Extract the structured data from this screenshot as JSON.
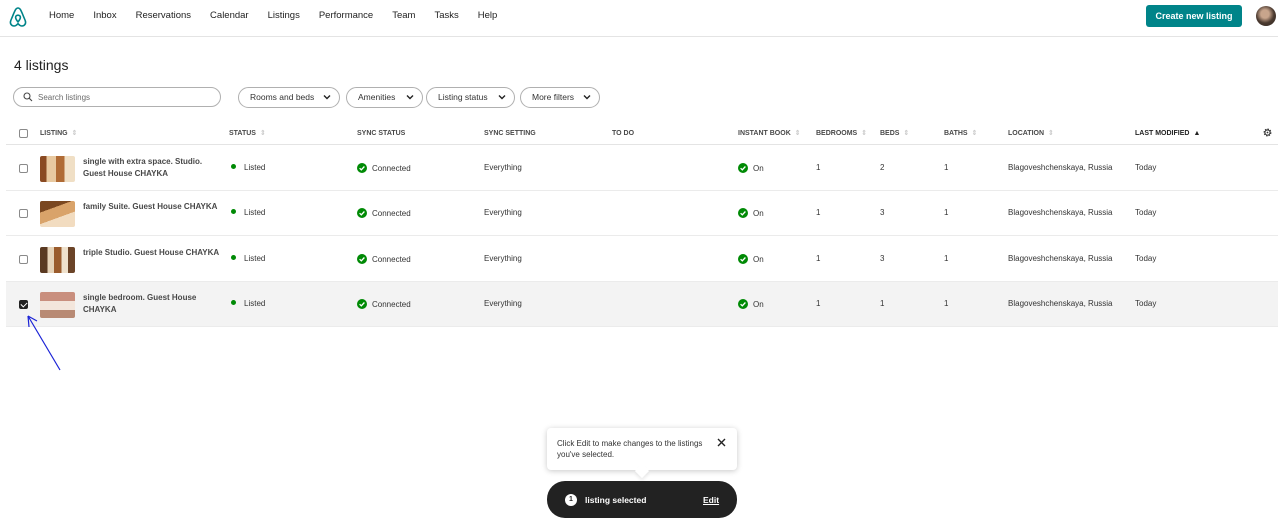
{
  "nav": {
    "items": [
      "Home",
      "Inbox",
      "Reservations",
      "Calendar",
      "Listings",
      "Performance",
      "Team",
      "Tasks",
      "Help"
    ],
    "create_button": "Create new listing",
    "logo_icon": "airbnb-logo-icon",
    "brand_color": "#008489"
  },
  "page": {
    "title": "4 listings"
  },
  "filters": {
    "search_placeholder": "Search listings",
    "pills": [
      "Rooms and beds",
      "Amenities",
      "Listing status",
      "More filters"
    ]
  },
  "table": {
    "columns": [
      "LISTING",
      "STATUS",
      "SYNC STATUS",
      "SYNC SETTING",
      "TO DO",
      "INSTANT BOOK",
      "BEDROOMS",
      "BEDS",
      "BATHS",
      "LOCATION",
      "LAST MODIFIED"
    ],
    "sorted_column": "LAST MODIFIED",
    "rows": [
      {
        "name": "single with extra space. Studio. Guest House CHAYKA",
        "status": "Listed",
        "sync_status": "Connected",
        "sync_setting": "Everything",
        "to_do": "",
        "instant_book": "On",
        "bedrooms": "1",
        "beds": "2",
        "baths": "1",
        "location": "Blagoveshchenskaya, Russia",
        "last_modified": "Today",
        "selected": false
      },
      {
        "name": "family Suite. Guest House CHAYKA",
        "status": "Listed",
        "sync_status": "Connected",
        "sync_setting": "Everything",
        "to_do": "",
        "instant_book": "On",
        "bedrooms": "1",
        "beds": "3",
        "baths": "1",
        "location": "Blagoveshchenskaya, Russia",
        "last_modified": "Today",
        "selected": false
      },
      {
        "name": "triple Studio. Guest House CHAYKA",
        "status": "Listed",
        "sync_status": "Connected",
        "sync_setting": "Everything",
        "to_do": "",
        "instant_book": "On",
        "bedrooms": "1",
        "beds": "3",
        "baths": "1",
        "location": "Blagoveshchenskaya, Russia",
        "last_modified": "Today",
        "selected": false
      },
      {
        "name": "single bedroom. Guest House CHAYKA",
        "status": "Listed",
        "sync_status": "Connected",
        "sync_setting": "Everything",
        "to_do": "",
        "instant_book": "On",
        "bedrooms": "1",
        "beds": "1",
        "baths": "1",
        "location": "Blagoveshchenskaya, Russia",
        "last_modified": "Today",
        "selected": true
      }
    ],
    "status_color": "#008a05"
  },
  "tooltip": {
    "text": "Click Edit to make changes to the listings you've selected."
  },
  "toast": {
    "count": "1",
    "label": "listing selected",
    "edit_label": "Edit"
  }
}
